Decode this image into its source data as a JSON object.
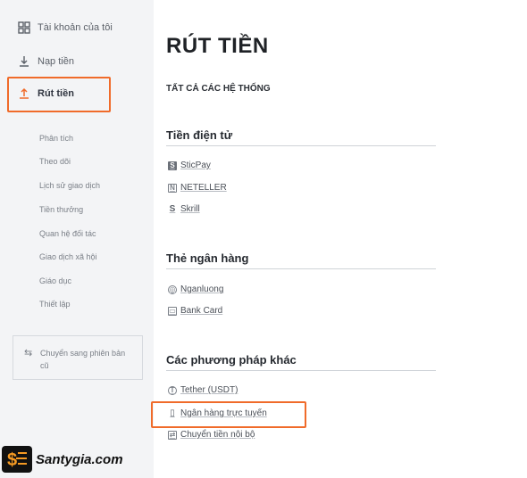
{
  "sidebar": {
    "items": [
      {
        "label": "Tài khoản của tôi",
        "icon": "grid-icon"
      },
      {
        "label": "Nạp tiền",
        "icon": "download-icon"
      },
      {
        "label": "Rút tiền",
        "icon": "upload-icon",
        "active": true
      }
    ],
    "sub_items": [
      "Phân tích",
      "Theo dõi",
      "Lịch sử giao dịch",
      "Tiền thưởng",
      "Quan hệ đối tác",
      "Giao dịch xã hội",
      "Giáo dục",
      "Thiết lập"
    ],
    "switch": {
      "label": "Chuyển sang phiên bản cũ",
      "icon": "swap-arrows-icon"
    }
  },
  "main": {
    "title": "RÚT TIỀN",
    "all_systems": "TẤT CẢ CÁC HỆ THỐNG",
    "sections": [
      {
        "title": "Tiền điện tử",
        "methods": [
          {
            "label": "SticPay",
            "icon": "sticpay-icon"
          },
          {
            "label": "NETELLER",
            "icon": "neteller-icon"
          },
          {
            "label": "Skrill",
            "icon": "skrill-icon"
          }
        ]
      },
      {
        "title": "Thẻ ngân hàng",
        "methods": [
          {
            "label": "Nganluong",
            "icon": "nganluong-icon"
          },
          {
            "label": "Bank Card",
            "icon": "bank-card-icon"
          }
        ]
      },
      {
        "title": "Các phương pháp khác",
        "methods": [
          {
            "label": "Tether (USDT)",
            "icon": "tether-icon"
          },
          {
            "label": "Ngân hàng trực tuyến",
            "icon": "online-bank-icon"
          },
          {
            "label": "Chuyển tiền nội bộ",
            "icon": "internal-transfer-icon"
          }
        ]
      }
    ]
  },
  "watermark": {
    "text": "Santygia.com"
  },
  "colors": {
    "highlight": "#f06b2a",
    "sidebar_bg": "#f3f4f6"
  }
}
